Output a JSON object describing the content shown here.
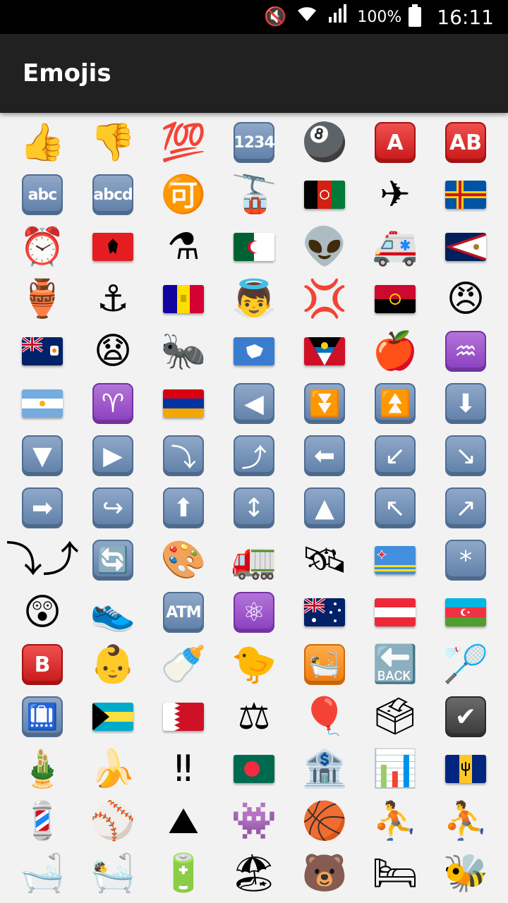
{
  "status_bar": {
    "mute_icon": "mute-icon",
    "wifi_icon": "wifi-icon",
    "signal_icon": "signal-icon",
    "battery_percent": "100%",
    "battery_icon": "battery-icon",
    "time": "16:11",
    "background": "#000000"
  },
  "app_bar": {
    "title": "Emojis",
    "background": "#212121"
  },
  "emojis": [
    {
      "name": "thumbs-up-icon",
      "kind": "glyph",
      "glyph": "👍"
    },
    {
      "name": "thumbs-down-icon",
      "kind": "glyph",
      "glyph": "👎"
    },
    {
      "name": "hundred-points-icon",
      "kind": "glyph",
      "glyph": "💯"
    },
    {
      "name": "input-numbers-icon",
      "kind": "tile",
      "style": "blue",
      "glyph": "1234"
    },
    {
      "name": "pool-8-ball-icon",
      "kind": "glyph",
      "glyph": "🎱"
    },
    {
      "name": "a-button-blood-type-icon",
      "kind": "tile",
      "style": "red",
      "glyph": "A"
    },
    {
      "name": "ab-button-blood-type-icon",
      "kind": "tile",
      "style": "red",
      "glyph": "AB"
    },
    {
      "name": "input-latin-letters-icon",
      "kind": "tile",
      "style": "blue",
      "glyph": "abc"
    },
    {
      "name": "input-latin-lowercase-icon",
      "kind": "tile",
      "style": "blue",
      "glyph": "abcd"
    },
    {
      "name": "japanese-acceptable-button-icon",
      "kind": "glyph",
      "glyph": "🉑"
    },
    {
      "name": "aerial-tramway-icon",
      "kind": "glyph",
      "glyph": "🚡"
    },
    {
      "name": "flag-afghanistan-icon",
      "kind": "flag",
      "flag": "af"
    },
    {
      "name": "airplane-icon",
      "kind": "glyph",
      "glyph": "✈"
    },
    {
      "name": "flag-aland-islands-icon",
      "kind": "flag",
      "flag": "ax"
    },
    {
      "name": "alarm-clock-icon",
      "kind": "glyph",
      "glyph": "⏰"
    },
    {
      "name": "flag-albania-icon",
      "kind": "flag",
      "flag": "al"
    },
    {
      "name": "alembic-icon",
      "kind": "glyph",
      "glyph": "⚗"
    },
    {
      "name": "flag-algeria-icon",
      "kind": "flag",
      "flag": "dz"
    },
    {
      "name": "alien-icon",
      "kind": "glyph",
      "glyph": "👽"
    },
    {
      "name": "ambulance-icon",
      "kind": "glyph",
      "glyph": "🚑"
    },
    {
      "name": "flag-american-samoa-icon",
      "kind": "flag",
      "flag": "as"
    },
    {
      "name": "amphora-icon",
      "kind": "glyph",
      "glyph": "🏺"
    },
    {
      "name": "anchor-icon",
      "kind": "glyph",
      "glyph": "⚓"
    },
    {
      "name": "flag-andorra-icon",
      "kind": "flag",
      "flag": "ad"
    },
    {
      "name": "baby-angel-icon",
      "kind": "glyph",
      "glyph": "👼"
    },
    {
      "name": "anger-symbol-icon",
      "kind": "glyph",
      "glyph": "💢"
    },
    {
      "name": "flag-angola-icon",
      "kind": "flag",
      "flag": "ao"
    },
    {
      "name": "angry-face-icon",
      "kind": "glyph",
      "glyph": "😠"
    },
    {
      "name": "flag-anguilla-icon",
      "kind": "flag",
      "flag": "ai"
    },
    {
      "name": "anguished-face-icon",
      "kind": "glyph",
      "glyph": "😧"
    },
    {
      "name": "ant-icon",
      "kind": "glyph",
      "glyph": "🐜"
    },
    {
      "name": "flag-antarctica-icon",
      "kind": "flag",
      "flag": "aq"
    },
    {
      "name": "flag-antigua-barbuda-icon",
      "kind": "flag",
      "flag": "ag"
    },
    {
      "name": "red-apple-icon",
      "kind": "glyph",
      "glyph": "🍎"
    },
    {
      "name": "aquarius-icon",
      "kind": "tile",
      "style": "purple",
      "glyph": "♒"
    },
    {
      "name": "flag-argentina-icon",
      "kind": "flag",
      "flag": "ar"
    },
    {
      "name": "aries-icon",
      "kind": "tile",
      "style": "purple",
      "glyph": "♈"
    },
    {
      "name": "flag-armenia-icon",
      "kind": "flag",
      "flag": "am"
    },
    {
      "name": "reverse-button-icon",
      "kind": "tile",
      "style": "blue",
      "glyph": "◀"
    },
    {
      "name": "fast-down-button-icon",
      "kind": "tile",
      "style": "blue",
      "glyph": "⏬"
    },
    {
      "name": "fast-up-button-icon",
      "kind": "tile",
      "style": "blue",
      "glyph": "⏫"
    },
    {
      "name": "down-arrow-icon",
      "kind": "tile",
      "style": "blue",
      "glyph": "⬇"
    },
    {
      "name": "downwards-button-icon",
      "kind": "tile",
      "style": "blue",
      "glyph": "▼"
    },
    {
      "name": "play-button-icon",
      "kind": "tile",
      "style": "blue",
      "glyph": "▶"
    },
    {
      "name": "right-arrow-curving-down-icon",
      "kind": "tile",
      "style": "blue",
      "glyph": "⤵"
    },
    {
      "name": "right-arrow-curving-up-icon",
      "kind": "tile",
      "style": "blue",
      "glyph": "⤴"
    },
    {
      "name": "left-arrow-icon",
      "kind": "tile",
      "style": "blue",
      "glyph": "⬅"
    },
    {
      "name": "down-left-arrow-icon",
      "kind": "tile",
      "style": "blue",
      "glyph": "↙"
    },
    {
      "name": "down-right-arrow-icon",
      "kind": "tile",
      "style": "blue",
      "glyph": "↘"
    },
    {
      "name": "right-arrow-icon",
      "kind": "tile",
      "style": "blue",
      "glyph": "➡"
    },
    {
      "name": "right-arrow-curving-left-icon",
      "kind": "tile",
      "style": "blue",
      "glyph": "↪"
    },
    {
      "name": "up-arrow-icon",
      "kind": "tile",
      "style": "blue",
      "glyph": "⬆"
    },
    {
      "name": "up-down-arrow-icon",
      "kind": "tile",
      "style": "blue",
      "glyph": "↕"
    },
    {
      "name": "upwards-button-icon",
      "kind": "tile",
      "style": "blue",
      "glyph": "▲"
    },
    {
      "name": "up-left-arrow-icon",
      "kind": "tile",
      "style": "blue",
      "glyph": "↖"
    },
    {
      "name": "up-right-arrow-icon",
      "kind": "tile",
      "style": "blue",
      "glyph": "↗"
    },
    {
      "name": "clockwise-vertical-arrows-icon",
      "kind": "glyph",
      "glyph": "⤵⤴"
    },
    {
      "name": "counterclockwise-arrows-button-icon",
      "kind": "tile",
      "style": "blue",
      "glyph": "🔄"
    },
    {
      "name": "artist-palette-icon",
      "kind": "glyph",
      "glyph": "🎨"
    },
    {
      "name": "articulated-lorry-icon",
      "kind": "glyph",
      "glyph": "🚛"
    },
    {
      "name": "satellite-icon",
      "kind": "glyph",
      "glyph": "🛰"
    },
    {
      "name": "flag-aruba-icon",
      "kind": "flag",
      "flag": "aw"
    },
    {
      "name": "asterisk-button-icon",
      "kind": "tile",
      "style": "blue",
      "glyph": "*"
    },
    {
      "name": "astonished-face-icon",
      "kind": "glyph",
      "glyph": "😲"
    },
    {
      "name": "running-shoe-icon",
      "kind": "glyph",
      "glyph": "👟"
    },
    {
      "name": "atm-sign-icon",
      "kind": "tile",
      "style": "blue",
      "glyph": "ATM"
    },
    {
      "name": "atom-symbol-icon",
      "kind": "tile",
      "style": "purple",
      "glyph": "⚛"
    },
    {
      "name": "flag-australia-icon",
      "kind": "flag",
      "flag": "au"
    },
    {
      "name": "flag-austria-icon",
      "kind": "flag",
      "flag": "at"
    },
    {
      "name": "flag-azerbaijan-icon",
      "kind": "flag",
      "flag": "az"
    },
    {
      "name": "b-button-blood-type-icon",
      "kind": "tile",
      "style": "red",
      "glyph": "B"
    },
    {
      "name": "baby-icon",
      "kind": "glyph",
      "glyph": "👶"
    },
    {
      "name": "baby-bottle-icon",
      "kind": "glyph",
      "glyph": "🍼"
    },
    {
      "name": "baby-chick-icon",
      "kind": "glyph",
      "glyph": "🐤"
    },
    {
      "name": "bath-room-sign-icon",
      "kind": "tile",
      "style": "orange",
      "glyph": "🛀"
    },
    {
      "name": "back-arrow-icon",
      "kind": "glyph",
      "glyph": "🔙"
    },
    {
      "name": "badminton-icon",
      "kind": "glyph",
      "glyph": "🏸"
    },
    {
      "name": "baggage-claim-icon",
      "kind": "tile",
      "style": "blue",
      "glyph": "🛄"
    },
    {
      "name": "flag-bahamas-icon",
      "kind": "flag",
      "flag": "bs"
    },
    {
      "name": "flag-bahrain-icon",
      "kind": "flag",
      "flag": "bh"
    },
    {
      "name": "balance-scale-icon",
      "kind": "glyph",
      "glyph": "⚖"
    },
    {
      "name": "balloon-icon",
      "kind": "glyph",
      "glyph": "🎈"
    },
    {
      "name": "ballot-box-icon",
      "kind": "glyph",
      "glyph": "🗳"
    },
    {
      "name": "check-box-icon",
      "kind": "tile",
      "style": "dark",
      "glyph": "✔"
    },
    {
      "name": "pine-decoration-icon",
      "kind": "glyph",
      "glyph": "🎍"
    },
    {
      "name": "banana-icon",
      "kind": "glyph",
      "glyph": "🍌"
    },
    {
      "name": "double-exclamation-icon",
      "kind": "glyph",
      "glyph": "‼"
    },
    {
      "name": "flag-bangladesh-icon",
      "kind": "flag",
      "flag": "bd"
    },
    {
      "name": "bank-icon",
      "kind": "glyph",
      "glyph": "🏦"
    },
    {
      "name": "bar-chart-icon",
      "kind": "glyph",
      "glyph": "📊"
    },
    {
      "name": "flag-barbados-icon",
      "kind": "flag",
      "flag": "bb"
    },
    {
      "name": "barber-pole-icon",
      "kind": "glyph",
      "glyph": "💈"
    },
    {
      "name": "baseball-icon",
      "kind": "glyph",
      "glyph": "⚾"
    },
    {
      "name": "basecamp-icon",
      "kind": "glyph",
      "glyph": "⛰"
    },
    {
      "name": "basecamp-guy-icon",
      "kind": "glyph",
      "glyph": "👾"
    },
    {
      "name": "basketball-icon",
      "kind": "glyph",
      "glyph": "🏀"
    },
    {
      "name": "man-bouncing-ball-icon",
      "kind": "glyph",
      "glyph": "⛹"
    },
    {
      "name": "woman-bouncing-ball-icon",
      "kind": "glyph",
      "glyph": "⛹"
    },
    {
      "name": "bathtub-icon",
      "kind": "glyph",
      "glyph": "🛁"
    },
    {
      "name": "person-taking-bath-icon",
      "kind": "glyph",
      "glyph": "🛀"
    },
    {
      "name": "battery-icon",
      "kind": "glyph",
      "glyph": "🔋"
    },
    {
      "name": "beach-with-umbrella-icon",
      "kind": "glyph",
      "glyph": "🏖"
    },
    {
      "name": "bear-face-icon",
      "kind": "glyph",
      "glyph": "🐻"
    },
    {
      "name": "bed-icon",
      "kind": "glyph",
      "glyph": "🛏"
    },
    {
      "name": "honeybee-icon",
      "kind": "glyph",
      "glyph": "🐝"
    }
  ]
}
